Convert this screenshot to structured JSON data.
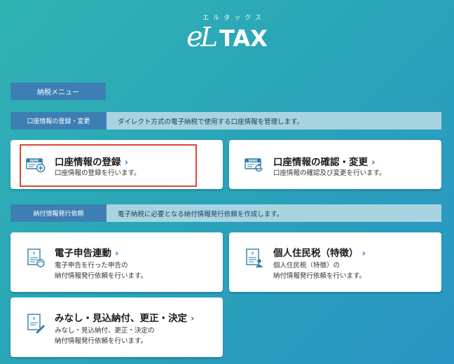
{
  "logo": {
    "kana": "エルタックス",
    "e": "e",
    "L": "L",
    "tax": "TAX"
  },
  "menu_label": "納税メニュー",
  "sections": [
    {
      "title": "口座情報の登録・変更",
      "description": "ダイレクト方式の電子納税で使用する口座情報を管理します。",
      "cards": [
        {
          "title": "口座情報の登録",
          "desc1": "口座情報の登録を行います。",
          "desc2": "",
          "icon": "bank-add-icon"
        },
        {
          "title": "口座情報の確認・変更",
          "desc1": "口座情報の確認及び変更を行います。",
          "desc2": "",
          "icon": "bank-refresh-icon"
        }
      ]
    },
    {
      "title": "納付情報発行依頼",
      "description": "電子納税に必要となる納付情報発行依頼を作成します。",
      "cards": [
        {
          "title": "電子申告連動",
          "desc1": "電子申告を行った申告の",
          "desc2": "納付情報発行依頼を行います。",
          "icon": "document-sync-icon"
        },
        {
          "title": "個人住民税（特徴）",
          "desc1": "個人住民税（特徴）の",
          "desc2": "納付情報発行依頼を行います。",
          "icon": "document-person-icon"
        },
        {
          "title": "みなし・見込納付、更正・決定",
          "desc1": "みなし・見込納付、更正・決定の",
          "desc2": "納付情報発行依頼を行います。",
          "icon": "document-edit-icon"
        }
      ]
    }
  ],
  "chevron": "›",
  "colors": {
    "accent": "#3d7fb3",
    "section_bar": "#a8d4e2",
    "highlight": "#e0443a",
    "link": "#2f7fc4"
  }
}
